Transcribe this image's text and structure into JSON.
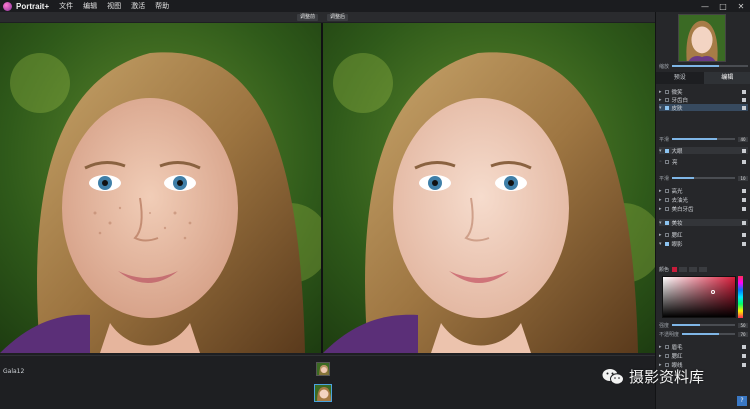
{
  "app": {
    "name": "Portrait+"
  },
  "menu": [
    "文件",
    "编辑",
    "视图",
    "激活",
    "帮助"
  ],
  "window_controls": [
    "—",
    "□",
    "✕"
  ],
  "panels": {
    "before_tag": "调整前",
    "after_tag": "调整后"
  },
  "filmstrip": {
    "file_name": "Gala12",
    "thumbnails": 2
  },
  "sidebar": {
    "zoom_label": "缩放",
    "zoom_level": 0.62,
    "tabs": [
      {
        "label": "预设",
        "active": false
      },
      {
        "label": "编辑",
        "active": true
      }
    ],
    "rows_top": [
      {
        "label": "微笑",
        "checked": false
      },
      {
        "label": "牙齿白",
        "checked": false
      },
      {
        "label": "皮肤",
        "checked": true,
        "selected": true
      }
    ],
    "slider_a": {
      "label": "平滑",
      "value": 0.72,
      "display": "40"
    },
    "section_makeup": {
      "label": "大眼",
      "checked": true
    },
    "makeup_sub": {
      "label": "亮",
      "checked": false
    },
    "slider_b": {
      "label": "平滑",
      "value": 0.35,
      "display": "10"
    },
    "rows_mid": [
      {
        "label": "高光",
        "checked": false
      },
      {
        "label": "去油光",
        "checked": false
      },
      {
        "label": "美白牙齿",
        "checked": false
      }
    ],
    "section_lips": {
      "label": "美妆",
      "checked": true
    },
    "rows_lips": [
      {
        "label": "腮红",
        "checked": false
      },
      {
        "label": "眼影",
        "checked": true
      }
    ],
    "color_label": "颜色",
    "color_value": "#c81b3a",
    "slider_c": {
      "label": "强度",
      "value": 0.45,
      "display": "50"
    },
    "slider_d": {
      "label": "不透明度",
      "value": 0.7,
      "display": "70"
    },
    "rows_bottom": [
      {
        "label": "眉毛",
        "checked": false
      },
      {
        "label": "腮红",
        "checked": false
      },
      {
        "label": "眼线",
        "checked": false
      }
    ],
    "help": "?"
  },
  "watermark": {
    "text": "摄影资料库"
  },
  "colors": {
    "accent": "#7fb6e6",
    "bg": "#1e1f22",
    "panel": "#26272a"
  }
}
